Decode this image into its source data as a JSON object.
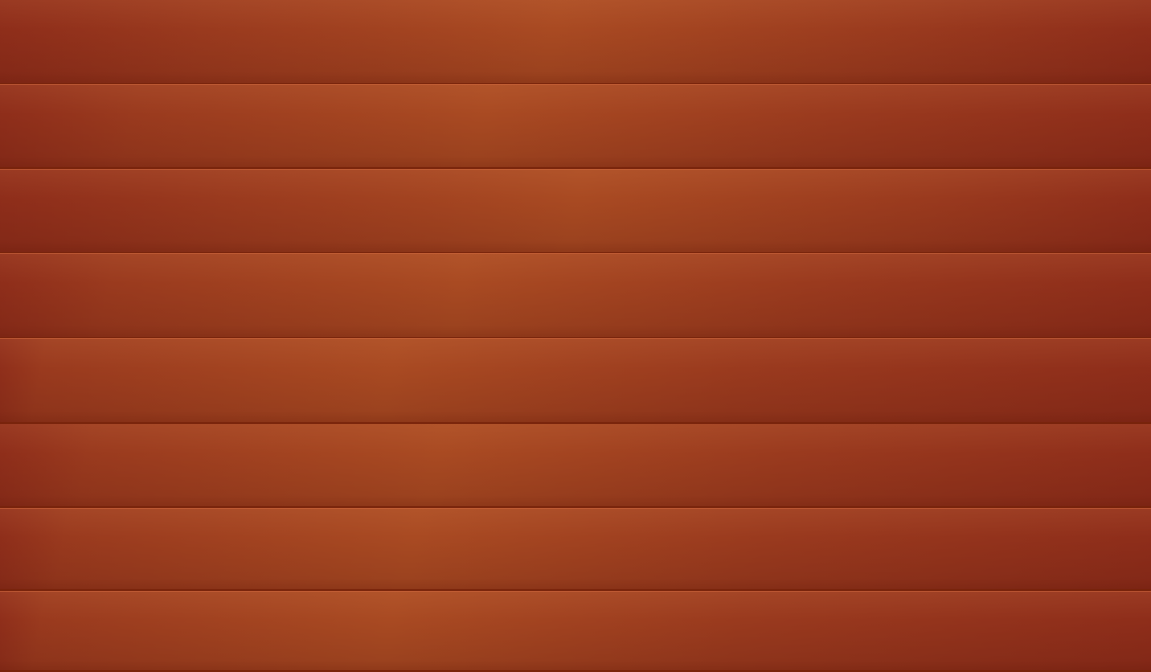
{
  "background": {
    "description_colors": {
      "base": "#9a3a1e",
      "highlight": "#a94a22",
      "shadow": "#8e2d1a",
      "groove": "#7a230a"
    },
    "slat_count": 8
  }
}
